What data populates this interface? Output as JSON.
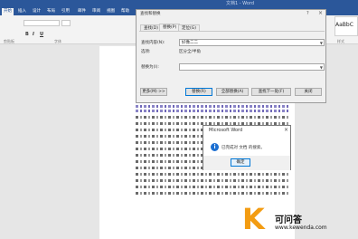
{
  "window": {
    "title": "文档1 - Word"
  },
  "ribbon": {
    "tabs": [
      "开始",
      "插入",
      "设计",
      "布局",
      "引用",
      "邮件",
      "审阅",
      "视图",
      "帮助"
    ],
    "format_buttons": [
      "B",
      "I",
      "U"
    ],
    "groups": {
      "clipboard": "剪贴板",
      "font": "字体",
      "styles": "样式"
    },
    "style_sample": "AaBbC"
  },
  "find_replace": {
    "title": "查找和替换",
    "help": "?",
    "tabs": [
      "查找(D)",
      "替换(P)",
      "定位(G)"
    ],
    "active_tab": 1,
    "find_label": "查找内容(N):",
    "find_value": "好像二二",
    "options_label": "选项:",
    "options_value": "区分全/半角",
    "replace_label": "替换为(I):",
    "replace_value": "",
    "buttons": {
      "more": "更多(M) >>",
      "replace": "替换(R)",
      "replace_all": "全部替换(A)",
      "find_next": "查找下一处(F)",
      "close": "关闭"
    }
  },
  "message_box": {
    "title": "Microsoft Word",
    "message": "已完成对 文档 的搜索。",
    "ok": "确定"
  },
  "watermark": {
    "logo_letter": "K",
    "name": "可问答",
    "url": "www.kewenda.com"
  }
}
